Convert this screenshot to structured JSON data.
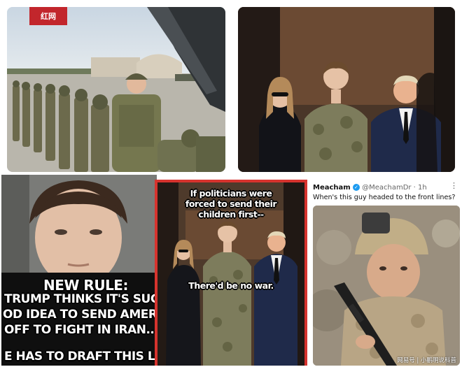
{
  "colors": {
    "meme_red": "#c2262c",
    "border_red": "#d6332e",
    "verified_blue": "#1d9bf0",
    "camo": "#7c7d5a",
    "navy_suit": "#1f2a4a"
  },
  "top_left": {
    "logo_text": "红网"
  },
  "bottom_left": {
    "line1": "NEW RULE:",
    "line2": "TRUMP THINKS IT'S SUCH",
    "line3": "OD IDEA TO SEND AMERICA",
    "line4": "OFF TO FIGHT IN IRAN...",
    "line5": "E HAS TO DRAFT THIS LITT"
  },
  "bottom_middle": {
    "caption_top": "If politicians were forced to send their children first--",
    "caption_bottom": "There'd be no war."
  },
  "bottom_right": {
    "name": "Meacham",
    "handle": "@MeachamDr · 1h",
    "tweet_text": "When's this guy headed to the front lines?",
    "more_icon": "ellipsis-icon",
    "verified_icon": "verified-badge-icon"
  },
  "watermark": {
    "text": "网易号 | 小鹏明说科普"
  }
}
